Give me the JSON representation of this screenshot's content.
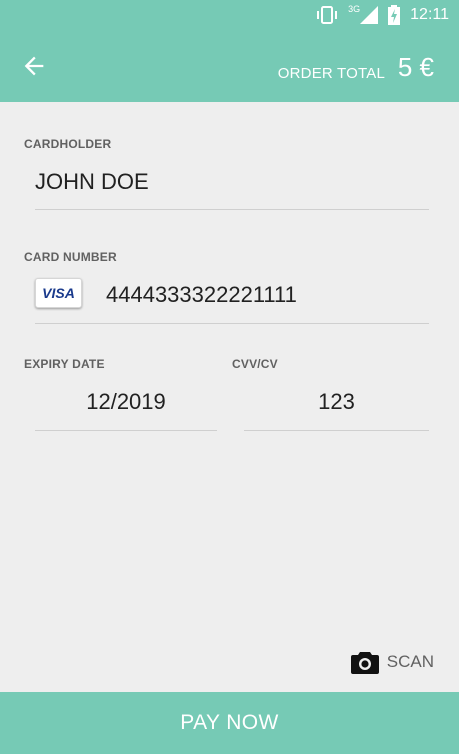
{
  "status_bar": {
    "network": "3G",
    "time": "12:11",
    "icons": [
      "vibrate-icon",
      "signal-icon",
      "battery-charging-icon"
    ]
  },
  "app_bar": {
    "back_icon": "arrow-left-icon",
    "order_total_label": "ORDER TOTAL",
    "order_total_value": "5 €"
  },
  "form": {
    "cardholder": {
      "label": "CARDHOLDER",
      "value": "JOHN DOE"
    },
    "card_number": {
      "label": "CARD NUMBER",
      "value": "4444333322221111",
      "card_brand": "VISA"
    },
    "expiry": {
      "label": "EXPIRY DATE",
      "value": "12/2019"
    },
    "cvv": {
      "label": "CVV/CV",
      "value": "123"
    }
  },
  "scan": {
    "icon": "camera-icon",
    "label": "SCAN"
  },
  "pay_button": {
    "label": "PAY NOW"
  },
  "colors": {
    "primary": "#76cab5",
    "background": "#eeeeee"
  }
}
